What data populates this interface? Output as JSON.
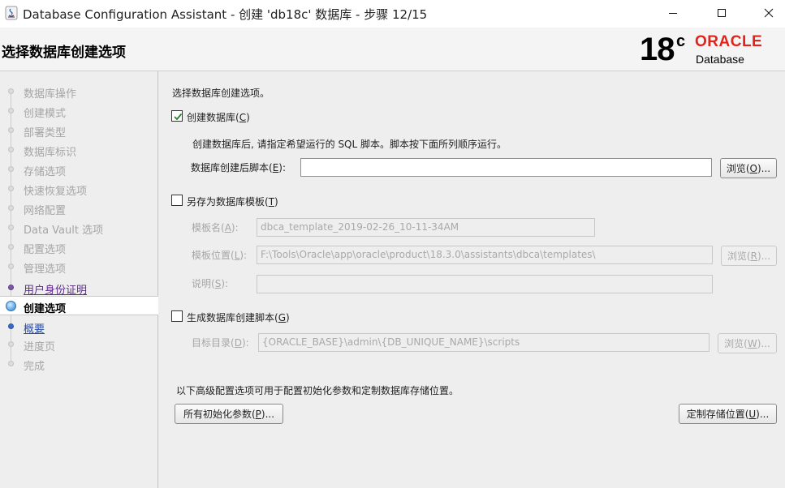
{
  "window": {
    "title": "Database Configuration Assistant - 创建 'db18c' 数据库 - 步骤 12/15"
  },
  "header": {
    "page_title": "选择数据库创建选项",
    "logo": {
      "version": "18",
      "version_suffix": "c",
      "brand": "ORACLE",
      "product": "Database",
      "brand_color": "#e2231a"
    }
  },
  "nav": {
    "items": [
      {
        "label": "数据库操作",
        "state": "done"
      },
      {
        "label": "创建模式",
        "state": "done"
      },
      {
        "label": "部署类型",
        "state": "done"
      },
      {
        "label": "数据库标识",
        "state": "done"
      },
      {
        "label": "存储选项",
        "state": "done"
      },
      {
        "label": "快速恢复选项",
        "state": "done"
      },
      {
        "label": "网络配置",
        "state": "done"
      },
      {
        "label": "Data Vault 选项",
        "state": "done"
      },
      {
        "label": "配置选项",
        "state": "done"
      },
      {
        "label": "管理选项",
        "state": "done"
      },
      {
        "label": "用户身份证明",
        "state": "visited"
      },
      {
        "label": "创建选项",
        "state": "current"
      },
      {
        "label": "概要",
        "state": "link"
      },
      {
        "label": "进度页",
        "state": "pending"
      },
      {
        "label": "完成",
        "state": "pending"
      }
    ]
  },
  "main": {
    "intro": "选择数据库创建选项。",
    "create_db": {
      "label_pre": "创建数据库(",
      "mnemonic": "C",
      "label_post": ")",
      "checked": true
    },
    "post_script_hint": "创建数据库后, 请指定希望运行的 SQL 脚本。脚本按下面所列顺序运行。",
    "post_script": {
      "label_pre": "数据库创建后脚本(",
      "mnemonic": "E",
      "label_post": "):",
      "value": ""
    },
    "browse_script": {
      "pre": "浏览(",
      "mnemonic": "O",
      "post": ")..."
    },
    "save_template": {
      "label_pre": "另存为数据库模板(",
      "mnemonic": "T",
      "label_post": ")",
      "checked": false
    },
    "template_name": {
      "label_pre": "模板名(",
      "mnemonic": "A",
      "label_post": "):",
      "value": "dbca_template_2019-02-26_10-11-34AM"
    },
    "template_location": {
      "label_pre": "模板位置(",
      "mnemonic": "L",
      "label_post": "):",
      "value": "F:\\Tools\\Oracle\\app\\oracle\\product\\18.3.0\\assistants\\dbca\\templates\\"
    },
    "browse_template": {
      "pre": "浏览(",
      "mnemonic": "R",
      "post": ")..."
    },
    "description": {
      "label_pre": "说明(",
      "mnemonic": "S",
      "label_post": "):",
      "value": ""
    },
    "gen_scripts": {
      "label_pre": "生成数据库创建脚本(",
      "mnemonic": "G",
      "label_post": ")",
      "checked": false
    },
    "target_dir": {
      "label_pre": "目标目录(",
      "mnemonic": "D",
      "label_post": "):",
      "value": "{ORACLE_BASE}\\admin\\{DB_UNIQUE_NAME}\\scripts"
    },
    "browse_dir": {
      "pre": "浏览(",
      "mnemonic": "W",
      "post": ")..."
    },
    "advanced_hint": "以下高级配置选项可用于配置初始化参数和定制数据库存储位置。",
    "init_params": {
      "pre": "所有初始化参数(",
      "mnemonic": "P",
      "post": ")..."
    },
    "storage_locations": {
      "pre": "定制存储位置(",
      "mnemonic": "U",
      "post": ")..."
    }
  }
}
